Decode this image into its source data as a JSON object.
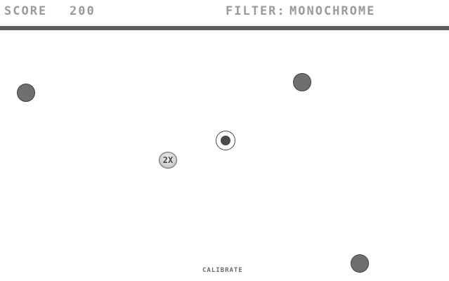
{
  "hud": {
    "score_label": "SCORE",
    "score_value": "200",
    "filter_label": "FILTER:",
    "filter_value": "MONOCHROME"
  },
  "powerup": {
    "label": "2X",
    "icon": "multiplier-powerup-icon"
  },
  "enemies": {
    "count": 3,
    "icon": "enemy-ball-icon"
  },
  "player": {
    "icon": "player-target-icon"
  },
  "controls": {
    "calibrate_label": "CALIBRATE"
  },
  "colors": {
    "background": "#ffffff",
    "hud_text": "#9a9a9a",
    "hud_bar": "#5c5c5c",
    "enemy": "#6f6f6f",
    "player_core": "#4b4b4b"
  }
}
